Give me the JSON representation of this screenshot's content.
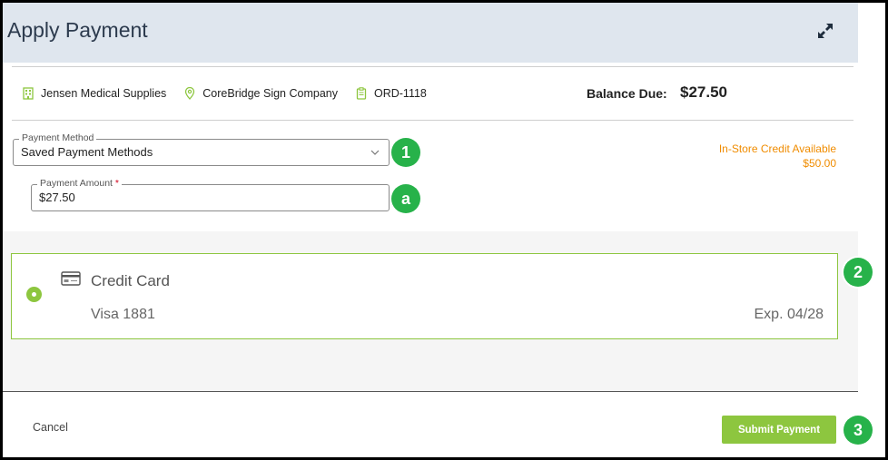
{
  "header": {
    "title": "Apply Payment"
  },
  "info": {
    "customer": "Jensen Medical Supplies",
    "company": "CoreBridge Sign Company",
    "order": "ORD-1118",
    "balance_label": "Balance Due:",
    "balance_value": "$27.50"
  },
  "payment_method": {
    "label": "Payment Method",
    "value": "Saved Payment Methods"
  },
  "payment_amount": {
    "label": "Payment Amount",
    "required_mark": "*",
    "value": "$27.50"
  },
  "store_credit": {
    "line1": "In-Store Credit Available",
    "line2": "$50.00"
  },
  "card": {
    "title": "Credit Card",
    "number": "Visa 1881",
    "expiry": "Exp. 04/28"
  },
  "callouts": {
    "one": "1",
    "a": "a",
    "two": "2",
    "three": "3"
  },
  "footer": {
    "cancel_label": "Cancel",
    "submit_label": "Submit Payment"
  },
  "colors": {
    "accent_green": "#8dc63f",
    "callout_green": "#27b24a",
    "credit_orange": "#f08c00",
    "header_bg": "#dfe6ee"
  },
  "icons": [
    "expand-icon",
    "building-icon",
    "location-pin-icon",
    "clipboard-icon",
    "chevron-down-icon",
    "credit-card-icon"
  ]
}
